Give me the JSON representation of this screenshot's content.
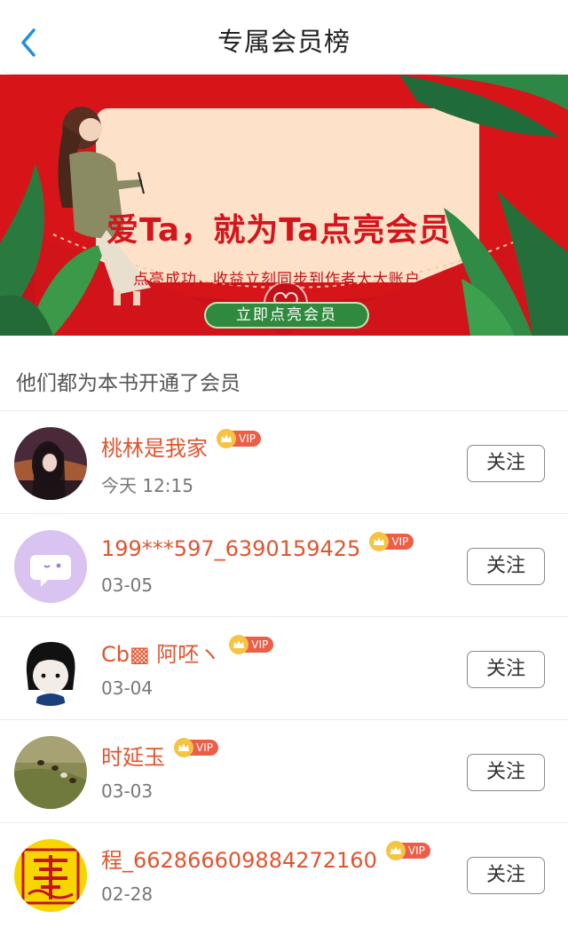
{
  "header": {
    "title": "专属会员榜",
    "back_icon": "chevron-left-icon",
    "accent": "#1e8fe3"
  },
  "banner": {
    "title": "爱Ta，就为Ta点亮会员",
    "subtitle": "点亮成功，收益立刻同步到作者大大账户",
    "button_label": "立即点亮会员"
  },
  "section": {
    "title": "他们都为本书开通了会员"
  },
  "members": [
    {
      "name": "桃林是我家",
      "date": "今天 12:15",
      "badge": "VIP",
      "follow_label": "关注"
    },
    {
      "name": "199***597_6390159425",
      "date": "03-05",
      "badge": "VIP",
      "follow_label": "关注"
    },
    {
      "name": "Cb▩ 阿呸ヽ",
      "date": "03-04",
      "badge": "VIP",
      "follow_label": "关注"
    },
    {
      "name": "时延玉",
      "date": "03-03",
      "badge": "VIP",
      "follow_label": "关注"
    },
    {
      "name": "程_662866609884272160",
      "date": "02-28",
      "badge": "VIP",
      "follow_label": "关注"
    }
  ],
  "colors": {
    "name": "#e0542f",
    "vip_badge": "#ee5d46",
    "banner_red": "#d71519",
    "banner_button": "#2f8a3e"
  }
}
